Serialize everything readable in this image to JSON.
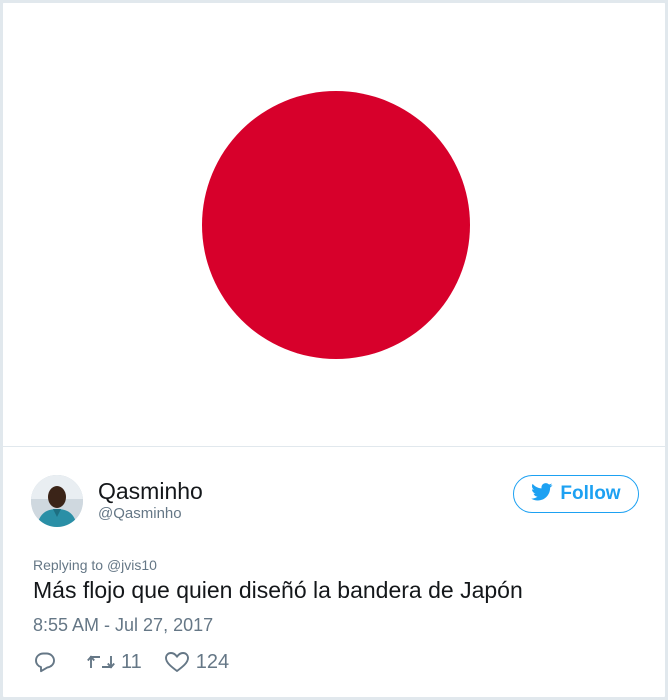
{
  "colors": {
    "flag_red": "#d7002b",
    "twitter_blue": "#1da1f2",
    "secondary_text": "#657786"
  },
  "tweet": {
    "display_name": "Qasminho",
    "handle": "@Qasminho",
    "follow_label": "Follow",
    "replying_prefix": "Replying to",
    "replying_to": "@jvis10",
    "text": "Más flojo que quien diseñó la bandera de Japón",
    "timestamp": "8:55 AM - Jul 27, 2017",
    "retweets": "11",
    "likes": "124"
  },
  "icons": {
    "follow": "twitter-bird-icon",
    "reply": "reply-icon",
    "retweet": "retweet-icon",
    "like": "heart-icon"
  }
}
